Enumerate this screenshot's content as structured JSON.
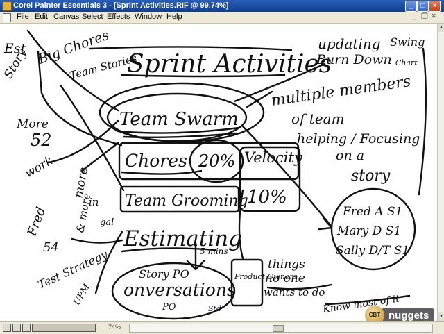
{
  "window": {
    "title": "Corel Painter Essentials 3 - [Sprint Activities.RIF @ 99.74%]"
  },
  "menu": [
    "File",
    "Edit",
    "Canvas",
    "Select",
    "Effects",
    "Window",
    "Help"
  ],
  "sketch": {
    "title": "Sprint Activities",
    "items": [
      "Team Swarm",
      "Chores",
      "20%",
      "Velocity",
      "10%",
      "Team Grooming",
      "Estimating",
      "Story PO",
      "onversations",
      "Product Owners"
    ],
    "left_notes": [
      "Est",
      "Story",
      "Big Chores",
      "Team Stories",
      "More",
      "52",
      "work",
      "Fred",
      "54",
      "Test Strategy",
      "UPM",
      "more",
      "in",
      "& more",
      "gal"
    ],
    "right_notes": [
      "updating",
      "Burn Down",
      "Swing",
      "Chart",
      "multiple members",
      "of team",
      "helping / Focusing",
      "on a",
      "story",
      "Fred A S1",
      "Mary D S1",
      "Sally D/T S1",
      "things",
      "no one",
      "wants to do",
      "Know most of it",
      "5 mins",
      "PO",
      "Std"
    ]
  },
  "status": {
    "zoom": "74%"
  },
  "watermark": {
    "badge": "CBT",
    "text": "nuggets"
  }
}
